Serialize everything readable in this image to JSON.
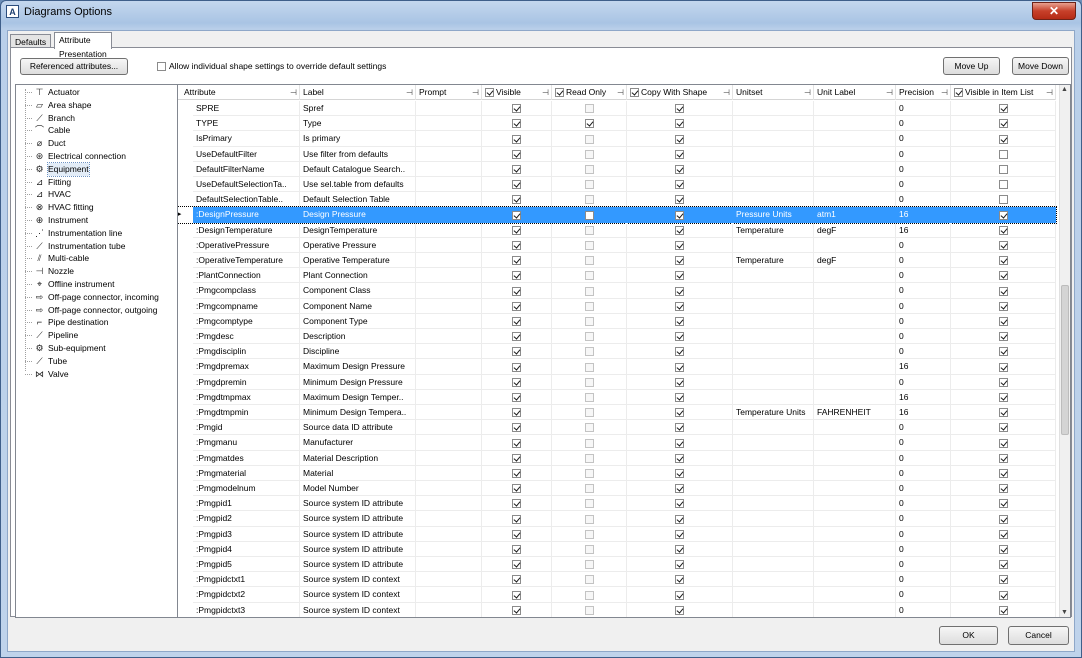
{
  "window": {
    "title": "Diagrams Options",
    "close_label": "✕"
  },
  "tabs": [
    {
      "label": "Defaults"
    },
    {
      "label": "Attribute Presentation"
    }
  ],
  "toolbar": {
    "referenced_label": "Referenced attributes...",
    "override_label": "Allow individual shape settings to override default settings",
    "move_up_label": "Move Up",
    "move_down_label": "Move Down"
  },
  "tree": {
    "selected": "Equipment",
    "items": [
      {
        "label": "Actuator",
        "icon": "actuator-icon",
        "glyph": "⊤"
      },
      {
        "label": "Area shape",
        "icon": "area-shape-icon",
        "glyph": "▱"
      },
      {
        "label": "Branch",
        "icon": "branch-icon",
        "glyph": "⟋"
      },
      {
        "label": "Cable",
        "icon": "cable-icon",
        "glyph": "⌒"
      },
      {
        "label": "Duct",
        "icon": "duct-icon",
        "glyph": "⌀"
      },
      {
        "label": "Electrical connection",
        "icon": "electrical-connection-icon",
        "glyph": "⊛"
      },
      {
        "label": "Equipment",
        "icon": "equipment-icon",
        "glyph": "⚙"
      },
      {
        "label": "Fitting",
        "icon": "fitting-icon",
        "glyph": "⊿"
      },
      {
        "label": "HVAC",
        "icon": "hvac-icon",
        "glyph": "⊿"
      },
      {
        "label": "HVAC fitting",
        "icon": "hvac-fitting-icon",
        "glyph": "⊗"
      },
      {
        "label": "Instrument",
        "icon": "instrument-icon",
        "glyph": "⊕"
      },
      {
        "label": "Instrumentation line",
        "icon": "instrumentation-line-icon",
        "glyph": "⋰"
      },
      {
        "label": "Instrumentation tube",
        "icon": "instrumentation-tube-icon",
        "glyph": "⟋"
      },
      {
        "label": "Multi-cable",
        "icon": "multi-cable-icon",
        "glyph": "⫽"
      },
      {
        "label": "Nozzle",
        "icon": "nozzle-icon",
        "glyph": "⊣"
      },
      {
        "label": "Offline instrument",
        "icon": "offline-instrument-icon",
        "glyph": "⌖"
      },
      {
        "label": "Off-page connector, incoming",
        "icon": "off-page-connector-incoming-icon",
        "glyph": "⇨"
      },
      {
        "label": "Off-page connector, outgoing",
        "icon": "off-page-connector-outgoing-icon",
        "glyph": "⇨"
      },
      {
        "label": "Pipe destination",
        "icon": "pipe-destination-icon",
        "glyph": "⌐"
      },
      {
        "label": "Pipeline",
        "icon": "pipeline-icon",
        "glyph": "⟋"
      },
      {
        "label": "Sub-equipment",
        "icon": "sub-equipment-icon",
        "glyph": "⚙"
      },
      {
        "label": "Tube",
        "icon": "tube-icon",
        "glyph": "⟋"
      },
      {
        "label": "Valve",
        "icon": "valve-icon",
        "glyph": "⋈"
      }
    ]
  },
  "grid": {
    "columns": [
      {
        "label": "Attribute",
        "check": false
      },
      {
        "label": "Label",
        "check": false
      },
      {
        "label": "Prompt",
        "check": false
      },
      {
        "label": "Visible",
        "check": true
      },
      {
        "label": "Read Only",
        "check": true
      },
      {
        "label": "Copy With Shape",
        "check": true
      },
      {
        "label": "Unitset",
        "check": false
      },
      {
        "label": "Unit Label",
        "check": false
      },
      {
        "label": "Precision",
        "check": false
      },
      {
        "label": "Visible in Item List",
        "check": true
      }
    ],
    "pin_glyph": "⊣",
    "selected_row": 7,
    "rows": [
      {
        "attribute": "SPRE",
        "label": "Spref",
        "prompt": "",
        "visible": true,
        "readonly": false,
        "readonly_disabled": true,
        "copy": true,
        "unitset": "",
        "unit_label": "",
        "precision": "0",
        "in_list": true
      },
      {
        "attribute": "TYPE",
        "label": "Type",
        "prompt": "",
        "visible": true,
        "readonly": true,
        "readonly_disabled": false,
        "copy": true,
        "unitset": "",
        "unit_label": "",
        "precision": "0",
        "in_list": true
      },
      {
        "attribute": "IsPrimary",
        "label": "Is primary",
        "prompt": "",
        "visible": true,
        "readonly": false,
        "readonly_disabled": true,
        "copy": true,
        "unitset": "",
        "unit_label": "",
        "precision": "0",
        "in_list": true
      },
      {
        "attribute": "UseDefaultFilter",
        "label": "Use filter from defaults",
        "prompt": "",
        "visible": true,
        "readonly": false,
        "readonly_disabled": true,
        "copy": true,
        "unitset": "",
        "unit_label": "",
        "precision": "0",
        "in_list": false
      },
      {
        "attribute": "DefaultFilterName",
        "label": "Default Catalogue Search..",
        "prompt": "",
        "visible": true,
        "readonly": false,
        "readonly_disabled": true,
        "copy": true,
        "unitset": "",
        "unit_label": "",
        "precision": "0",
        "in_list": false
      },
      {
        "attribute": "UseDefaultSelectionTa..",
        "label": "Use sel.table from defaults",
        "prompt": "",
        "visible": true,
        "readonly": false,
        "readonly_disabled": true,
        "copy": true,
        "unitset": "",
        "unit_label": "",
        "precision": "0",
        "in_list": false
      },
      {
        "attribute": "DefaultSelectionTable..",
        "label": "Default Selection Table",
        "prompt": "",
        "visible": true,
        "readonly": false,
        "readonly_disabled": true,
        "copy": true,
        "unitset": "",
        "unit_label": "",
        "precision": "0",
        "in_list": false
      },
      {
        "attribute": ":DesignPressure",
        "label": "Design Pressure",
        "prompt": "",
        "visible": true,
        "readonly": false,
        "readonly_disabled": false,
        "copy": true,
        "unitset": "Pressure Units",
        "unit_label": "atm1",
        "precision": "16",
        "in_list": true
      },
      {
        "attribute": ":DesignTemperature",
        "label": "DesignTemperature",
        "prompt": "",
        "visible": true,
        "readonly": false,
        "readonly_disabled": true,
        "copy": true,
        "unitset": "Temperature",
        "unit_label": "degF",
        "precision": "16",
        "in_list": true
      },
      {
        "attribute": ":OperativePressure",
        "label": "Operative Pressure",
        "prompt": "",
        "visible": true,
        "readonly": false,
        "readonly_disabled": true,
        "copy": true,
        "unitset": "",
        "unit_label": "",
        "precision": "0",
        "in_list": true
      },
      {
        "attribute": ":OperativeTemperature",
        "label": "Operative Temperature",
        "prompt": "",
        "visible": true,
        "readonly": false,
        "readonly_disabled": true,
        "copy": true,
        "unitset": "Temperature",
        "unit_label": "degF",
        "precision": "0",
        "in_list": true
      },
      {
        "attribute": ":PlantConnection",
        "label": "Plant Connection",
        "prompt": "",
        "visible": true,
        "readonly": false,
        "readonly_disabled": true,
        "copy": true,
        "unitset": "",
        "unit_label": "",
        "precision": "0",
        "in_list": true
      },
      {
        "attribute": ":Pmgcompclass",
        "label": "Component Class",
        "prompt": "",
        "visible": true,
        "readonly": false,
        "readonly_disabled": true,
        "copy": true,
        "unitset": "",
        "unit_label": "",
        "precision": "0",
        "in_list": true
      },
      {
        "attribute": ":Pmgcompname",
        "label": "Component Name",
        "prompt": "",
        "visible": true,
        "readonly": false,
        "readonly_disabled": true,
        "copy": true,
        "unitset": "",
        "unit_label": "",
        "precision": "0",
        "in_list": true
      },
      {
        "attribute": ":Pmgcomptype",
        "label": "Component Type",
        "prompt": "",
        "visible": true,
        "readonly": false,
        "readonly_disabled": true,
        "copy": true,
        "unitset": "",
        "unit_label": "",
        "precision": "0",
        "in_list": true
      },
      {
        "attribute": ":Pmgdesc",
        "label": "Description",
        "prompt": "",
        "visible": true,
        "readonly": false,
        "readonly_disabled": true,
        "copy": true,
        "unitset": "",
        "unit_label": "",
        "precision": "0",
        "in_list": true
      },
      {
        "attribute": ":Pmgdisciplin",
        "label": "Discipline",
        "prompt": "",
        "visible": true,
        "readonly": false,
        "readonly_disabled": true,
        "copy": true,
        "unitset": "",
        "unit_label": "",
        "precision": "0",
        "in_list": true
      },
      {
        "attribute": ":Pmgdpremax",
        "label": "Maximum Design Pressure",
        "prompt": "",
        "visible": true,
        "readonly": false,
        "readonly_disabled": true,
        "copy": true,
        "unitset": "",
        "unit_label": "",
        "precision": "16",
        "in_list": true
      },
      {
        "attribute": ":Pmgdpremin",
        "label": "Minimum Design Pressure",
        "prompt": "",
        "visible": true,
        "readonly": false,
        "readonly_disabled": true,
        "copy": true,
        "unitset": "",
        "unit_label": "",
        "precision": "0",
        "in_list": true
      },
      {
        "attribute": ":Pmgdtmpmax",
        "label": "Maximum Design Temper..",
        "prompt": "",
        "visible": true,
        "readonly": false,
        "readonly_disabled": true,
        "copy": true,
        "unitset": "",
        "unit_label": "",
        "precision": "16",
        "in_list": true
      },
      {
        "attribute": ":Pmgdtmpmin",
        "label": "Minimum Design Tempera..",
        "prompt": "",
        "visible": true,
        "readonly": false,
        "readonly_disabled": true,
        "copy": true,
        "unitset": "Temperature Units",
        "unit_label": "FAHRENHEIT",
        "precision": "16",
        "in_list": true
      },
      {
        "attribute": ":Pmgid",
        "label": "Source data ID attribute",
        "prompt": "",
        "visible": true,
        "readonly": false,
        "readonly_disabled": true,
        "copy": true,
        "unitset": "",
        "unit_label": "",
        "precision": "0",
        "in_list": true
      },
      {
        "attribute": ":Pmgmanu",
        "label": "Manufacturer",
        "prompt": "",
        "visible": true,
        "readonly": false,
        "readonly_disabled": true,
        "copy": true,
        "unitset": "",
        "unit_label": "",
        "precision": "0",
        "in_list": true
      },
      {
        "attribute": ":Pmgmatdes",
        "label": "Material Description",
        "prompt": "",
        "visible": true,
        "readonly": false,
        "readonly_disabled": true,
        "copy": true,
        "unitset": "",
        "unit_label": "",
        "precision": "0",
        "in_list": true
      },
      {
        "attribute": ":Pmgmaterial",
        "label": "Material",
        "prompt": "",
        "visible": true,
        "readonly": false,
        "readonly_disabled": true,
        "copy": true,
        "unitset": "",
        "unit_label": "",
        "precision": "0",
        "in_list": true
      },
      {
        "attribute": ":Pmgmodelnum",
        "label": "Model Number",
        "prompt": "",
        "visible": true,
        "readonly": false,
        "readonly_disabled": true,
        "copy": true,
        "unitset": "",
        "unit_label": "",
        "precision": "0",
        "in_list": true
      },
      {
        "attribute": ":Pmgpid1",
        "label": "Source system ID attribute",
        "prompt": "",
        "visible": true,
        "readonly": false,
        "readonly_disabled": true,
        "copy": true,
        "unitset": "",
        "unit_label": "",
        "precision": "0",
        "in_list": true
      },
      {
        "attribute": ":Pmgpid2",
        "label": "Source system ID attribute",
        "prompt": "",
        "visible": true,
        "readonly": false,
        "readonly_disabled": true,
        "copy": true,
        "unitset": "",
        "unit_label": "",
        "precision": "0",
        "in_list": true
      },
      {
        "attribute": ":Pmgpid3",
        "label": "Source system ID attribute",
        "prompt": "",
        "visible": true,
        "readonly": false,
        "readonly_disabled": true,
        "copy": true,
        "unitset": "",
        "unit_label": "",
        "precision": "0",
        "in_list": true
      },
      {
        "attribute": ":Pmgpid4",
        "label": "Source system ID attribute",
        "prompt": "",
        "visible": true,
        "readonly": false,
        "readonly_disabled": true,
        "copy": true,
        "unitset": "",
        "unit_label": "",
        "precision": "0",
        "in_list": true
      },
      {
        "attribute": ":Pmgpid5",
        "label": "Source system ID attribute",
        "prompt": "",
        "visible": true,
        "readonly": false,
        "readonly_disabled": true,
        "copy": true,
        "unitset": "",
        "unit_label": "",
        "precision": "0",
        "in_list": true
      },
      {
        "attribute": ":Pmgpidctxt1",
        "label": "Source system ID context",
        "prompt": "",
        "visible": true,
        "readonly": false,
        "readonly_disabled": true,
        "copy": true,
        "unitset": "",
        "unit_label": "",
        "precision": "0",
        "in_list": true
      },
      {
        "attribute": ":Pmgpidctxt2",
        "label": "Source system ID context",
        "prompt": "",
        "visible": true,
        "readonly": false,
        "readonly_disabled": true,
        "copy": true,
        "unitset": "",
        "unit_label": "",
        "precision": "0",
        "in_list": true
      },
      {
        "attribute": ":Pmgpidctxt3",
        "label": "Source system ID context",
        "prompt": "",
        "visible": true,
        "readonly": false,
        "readonly_disabled": true,
        "copy": true,
        "unitset": "",
        "unit_label": "",
        "precision": "0",
        "in_list": true
      }
    ]
  },
  "footer": {
    "ok_label": "OK",
    "cancel_label": "Cancel"
  }
}
